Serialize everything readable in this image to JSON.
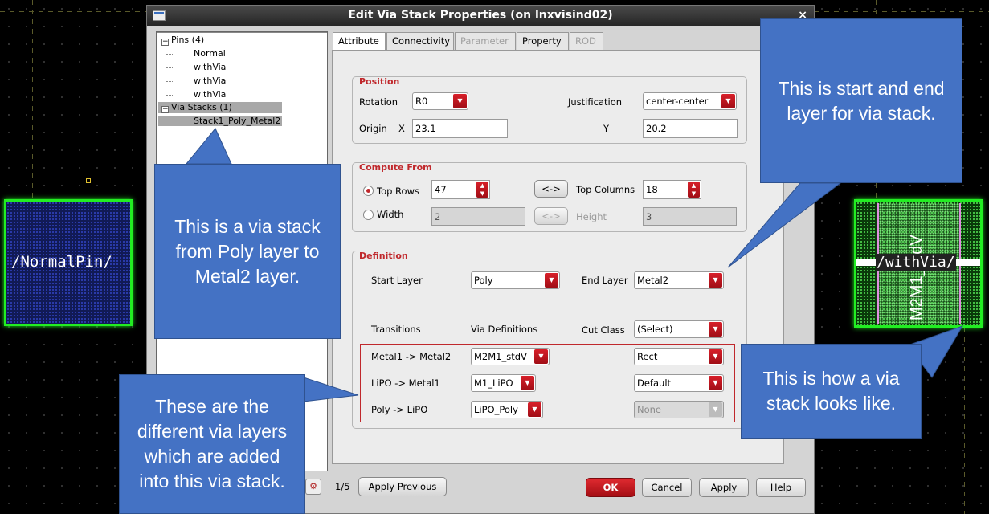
{
  "canvas": {
    "pins": {
      "normal_label": "/NormalPin/",
      "via_label": "/withVia/",
      "via_vertical_label": "M2M1_stdV"
    }
  },
  "dialog": {
    "title": "Edit Via Stack Properties (on lnxvisind02)",
    "close": "×",
    "tree": {
      "pins_root": "Pins (4)",
      "pins": [
        "Normal",
        "withVia",
        "withVia",
        "withVia"
      ],
      "stacks_root": "Via Stacks (1)",
      "stack_item": "Stack1_Poly_Metal2",
      "collapse_glyph": "−"
    },
    "tabs": [
      "Attribute",
      "Connectivity",
      "Parameter",
      "Property",
      "ROD"
    ],
    "position": {
      "title": "Position",
      "rotation_label": "Rotation",
      "rotation_value": "R0",
      "justification_label": "Justification",
      "justification_value": "center-center",
      "origin_label": "Origin",
      "x_label": "X",
      "x_value": "23.1",
      "y_label": "Y",
      "y_value": "20.2"
    },
    "compute": {
      "title": "Compute From",
      "top_rows_label": "Top Rows",
      "top_rows_value": "47",
      "swap_label": "<->",
      "top_columns_label": "Top Columns",
      "top_columns_value": "18",
      "width_label": "Width",
      "width_value": "2",
      "height_label": "Height",
      "height_value": "3"
    },
    "definition": {
      "title": "Definition",
      "start_layer_label": "Start Layer",
      "start_layer_value": "Poly",
      "end_layer_label": "End Layer",
      "end_layer_value": "Metal2",
      "transitions_header": "Transitions",
      "via_defs_header": "Via Definitions",
      "cut_class_header": "Cut Class",
      "cut_class_value": "(Select)",
      "rows": [
        {
          "transition": "Metal1 -> Metal2",
          "via": "M2M1_stdV",
          "cut": "Rect"
        },
        {
          "transition": "LiPO -> Metal1",
          "via": "M1_LiPO",
          "cut": "Default"
        },
        {
          "transition": "Poly -> LiPO",
          "via": "LiPO_Poly",
          "cut": "None"
        }
      ]
    },
    "footer": {
      "page": "1/5",
      "apply_previous": "Apply Previous",
      "ok": "OK",
      "cancel": "Cancel",
      "apply": "Apply",
      "help": "Help"
    }
  },
  "callouts": {
    "via_stack": "This is a via stack from Poly layer to Metal2 layer.",
    "start_end": "This is start and end layer for via stack.",
    "via_layers": "These are the different via layers which are added into this via stack.",
    "looks_like": "This is how a via stack looks like."
  },
  "colors": {
    "callout": "#4472c4",
    "accent_red": "#c0282c",
    "pin_green": "#22ee22"
  }
}
